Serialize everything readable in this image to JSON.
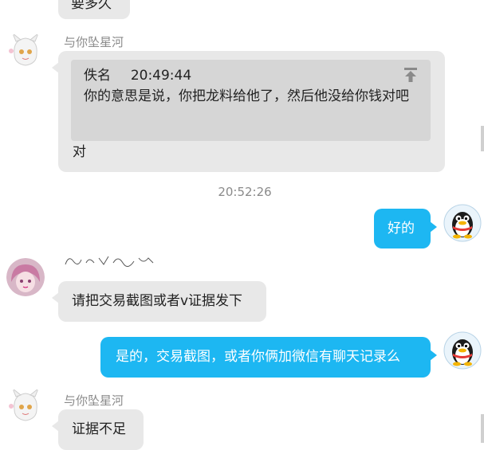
{
  "messages": {
    "top_partial": "要多久",
    "m1": {
      "sender": "与你坠星河",
      "quote_name": "佚名",
      "quote_time": "20:49:44",
      "quote_text": "你的意思是说，你把龙料给他了，然后他没给你钱对吧",
      "reply": "对"
    },
    "timestamp": "20:52:26",
    "m2": {
      "text": "好的"
    },
    "m3": {
      "text": "请把交易截图或者v证据发下"
    },
    "m4": {
      "text": "是的，交易截图，或者你俩加微信有聊天记录么"
    },
    "m5": {
      "sender": "与你坠星河",
      "text": "证据不足"
    }
  },
  "icons": {
    "quote_jump": "jump-to-top-icon",
    "avatar_left": "anime-girl-avatar",
    "avatar_pink": "pink-hair-avatar",
    "avatar_right": "qq-penguin-avatar"
  },
  "colors": {
    "bubble_left": "#e8e8e8",
    "bubble_right": "#1db7f2",
    "quote_bg": "#d6d6d6",
    "meta_text": "#8a8a8a"
  }
}
